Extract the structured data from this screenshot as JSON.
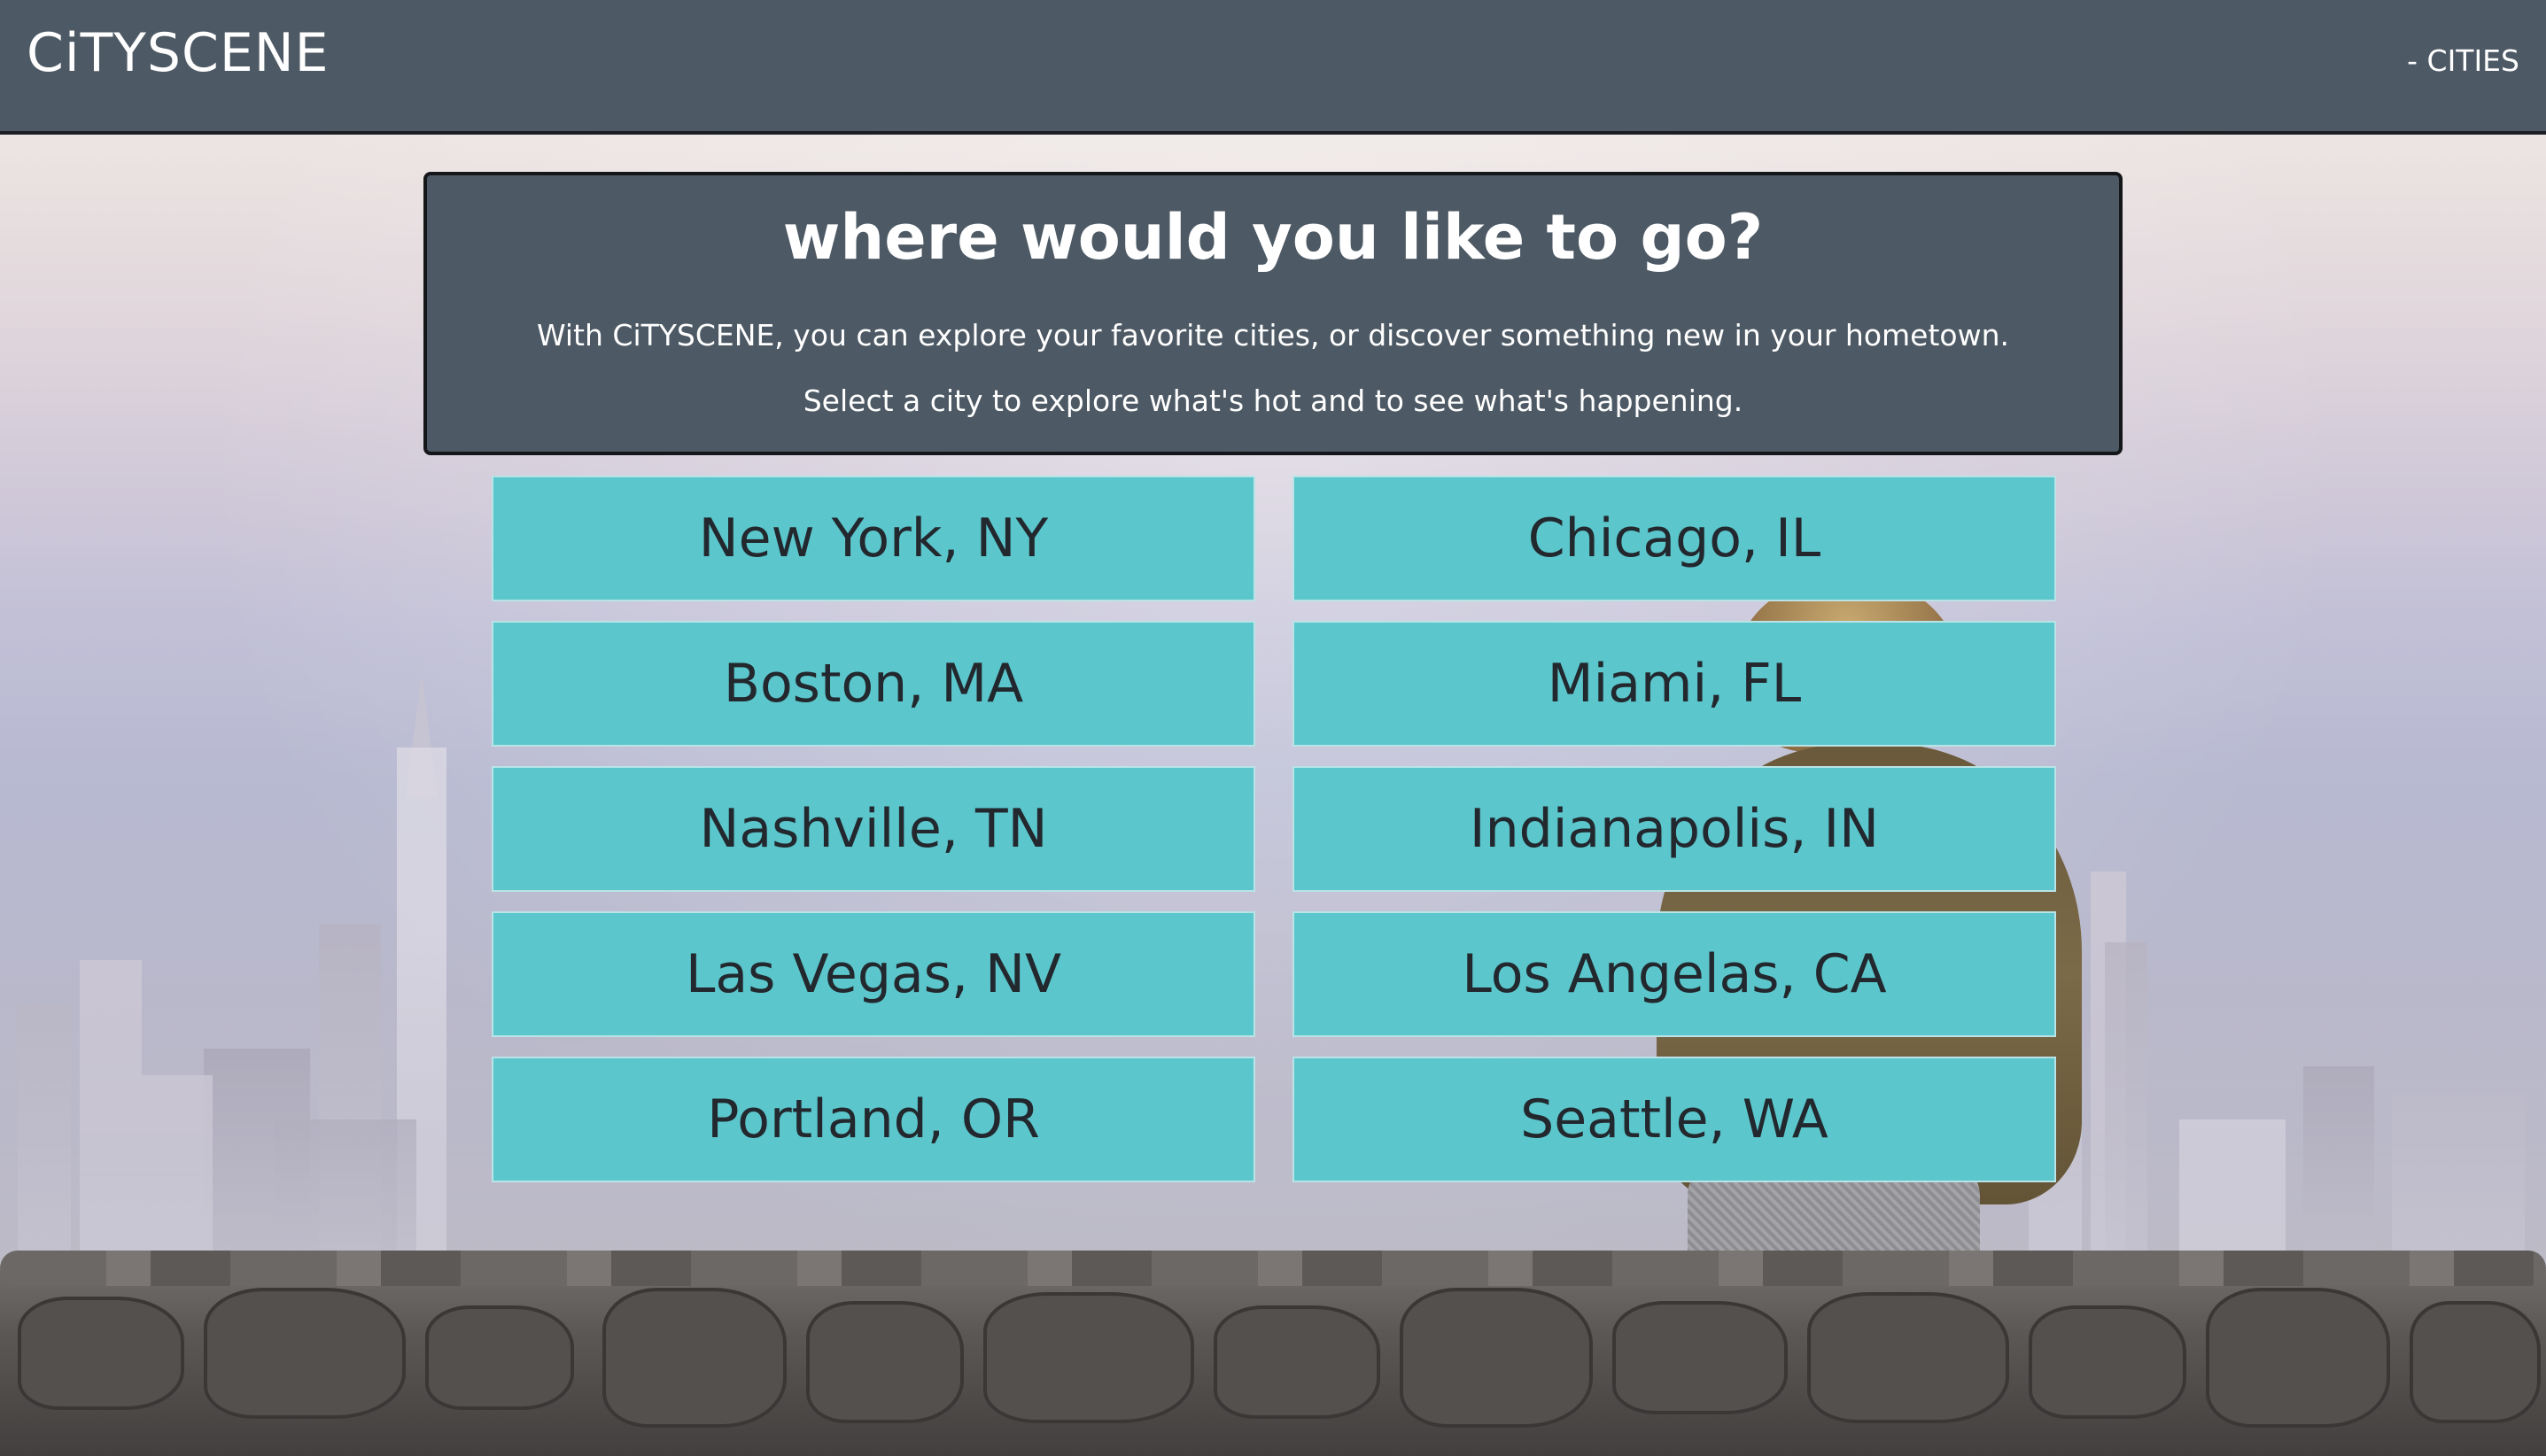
{
  "header": {
    "brand": "CiTYSCENE",
    "nav_link": "- CITIES"
  },
  "intro": {
    "title": "where would you like to go?",
    "line1": "With CiTYSCENE, you can explore your favorite cities, or discover something new in your hometown.",
    "line2": "Select a city to explore what's hot and to see what's happening."
  },
  "cities": [
    {
      "label": "New York, NY"
    },
    {
      "label": "Chicago, IL"
    },
    {
      "label": "Boston, MA"
    },
    {
      "label": "Miami, FL"
    },
    {
      "label": "Nashville, TN"
    },
    {
      "label": "Indianapolis, IN"
    },
    {
      "label": "Las Vegas, NV"
    },
    {
      "label": "Los Angelas, CA"
    },
    {
      "label": "Portland, OR"
    },
    {
      "label": "Seattle, WA"
    }
  ],
  "colors": {
    "header_bg": "#4d5964",
    "button_bg": "#5bc6cc",
    "button_text": "#22282d",
    "text_light": "#ffffff"
  }
}
